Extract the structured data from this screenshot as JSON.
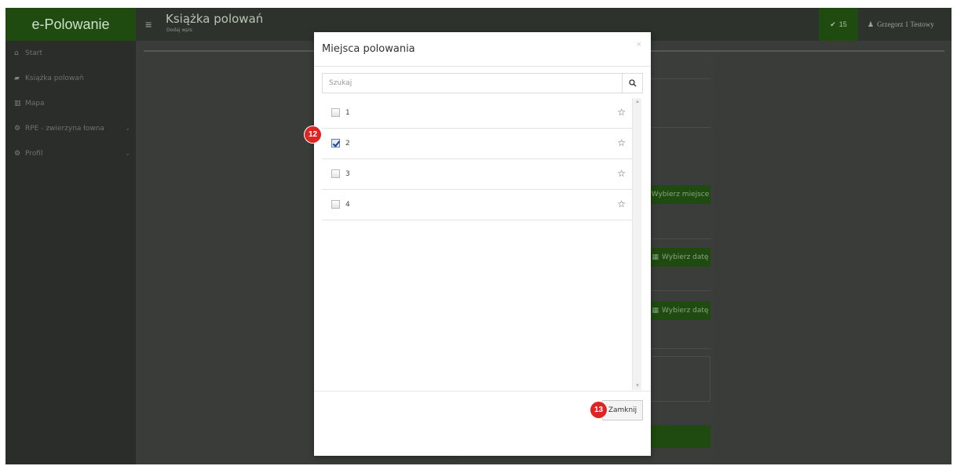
{
  "app": {
    "brand": "e-Polowanie"
  },
  "sidebar": {
    "items": [
      {
        "label": "Start",
        "icon": "home-icon"
      },
      {
        "label": "Książka polowań",
        "icon": "book-icon"
      },
      {
        "label": "Mapa",
        "icon": "map-icon"
      },
      {
        "label": "RPE - zwierzyna łowna",
        "icon": "cogs-icon",
        "expandable": true
      },
      {
        "label": "Profil",
        "icon": "cogs-icon",
        "expandable": true
      }
    ]
  },
  "header": {
    "title": "Książka polowań",
    "subtitle": "Dodaj wpis",
    "notifications_count": "15",
    "user_name": "Grzegorz 1 Testowy"
  },
  "background_form": {
    "choose_place_label": "Wybierz miejsce",
    "choose_date_label_1": "Wybierz datę",
    "choose_date_label_2": "Wybierz datę"
  },
  "modal": {
    "title": "Miejsca polowania",
    "close_symbol": "×",
    "search_placeholder": "Szukaj",
    "items": [
      {
        "label": "1",
        "checked": false
      },
      {
        "label": "2",
        "checked": true
      },
      {
        "label": "3",
        "checked": false
      },
      {
        "label": "4",
        "checked": false
      }
    ],
    "close_button_label": "Zamknij"
  },
  "markers": {
    "step_12": "12",
    "step_13": "13"
  },
  "colors": {
    "brand_green": "#1f4a10",
    "marker_red": "#e02424",
    "sidebar_bg": "#2a2d2a"
  }
}
